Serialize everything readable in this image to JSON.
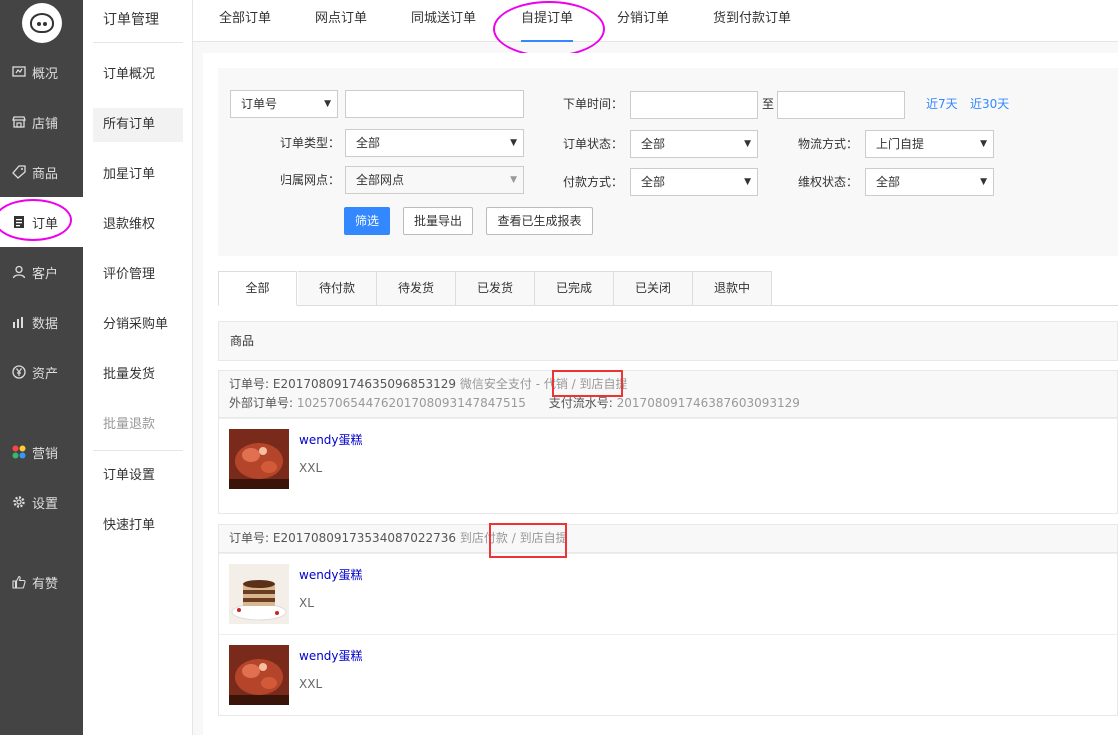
{
  "sidebar": {
    "items": [
      {
        "label": "概况",
        "icon": "overview-icon"
      },
      {
        "label": "店铺",
        "icon": "store-icon"
      },
      {
        "label": "商品",
        "icon": "tag-icon"
      },
      {
        "label": "订单",
        "icon": "order-icon"
      },
      {
        "label": "客户",
        "icon": "user-icon"
      },
      {
        "label": "数据",
        "icon": "chart-icon"
      },
      {
        "label": "资产",
        "icon": "yen-icon"
      },
      {
        "label": "营销",
        "icon": "apps-icon"
      },
      {
        "label": "设置",
        "icon": "gear-icon"
      },
      {
        "label": "有赞",
        "icon": "thumbs-up-icon"
      }
    ]
  },
  "subnav": {
    "title": "订单管理",
    "items": [
      "订单概况",
      "所有订单",
      "加星订单",
      "退款维权",
      "评价管理",
      "分销采购单",
      "批量发货",
      "批量退款",
      "订单设置",
      "快速打单"
    ]
  },
  "toptabs": [
    "全部订单",
    "网点订单",
    "同城送订单",
    "自提订单",
    "分销订单",
    "货到付款订单"
  ],
  "filter": {
    "order_no_select": "订单号",
    "order_time_label": "下单时间：",
    "to_label": "至",
    "last7": "近7天",
    "last30": "近30天",
    "order_type_label": "订单类型：",
    "order_type_value": "全部",
    "order_status_label": "订单状态：",
    "order_status_value": "全部",
    "logistics_label": "物流方式：",
    "logistics_value": "上门自提",
    "outlet_label": "归属网点：",
    "outlet_value": "全部网点",
    "pay_label": "付款方式：",
    "pay_value": "全部",
    "rights_label": "维权状态：",
    "rights_value": "全部",
    "filter_btn": "筛选",
    "export_btn": "批量导出",
    "report_btn": "查看已生成报表"
  },
  "status_tabs": [
    "全部",
    "待付款",
    "待发货",
    "已发货",
    "已完成",
    "已关闭",
    "退款中"
  ],
  "table_header": "商品",
  "orders": [
    {
      "order_no_label": "订单号: ",
      "order_no": "E20170809174635096853129",
      "pay": "微信安全支付 - 代销",
      "sep": " / ",
      "pickup": "到店自提",
      "ext_label": "外部订单号: ",
      "ext_no": "1025706544762017080931478475​15",
      "flow_label": "支付流水号: ",
      "flow_no": "2017080917463876030931​29",
      "items": [
        {
          "name": "wendy蛋糕",
          "sku": "XXL",
          "img": "cake-red-image"
        }
      ]
    },
    {
      "order_no_label": "订单号: ",
      "order_no": "E20170809173534087022736",
      "pay": "到店付款",
      "sep": " / ",
      "pickup": "到店自提",
      "items": [
        {
          "name": "wendy蛋糕",
          "sku": "XL",
          "img": "cake-tiramisu-image"
        },
        {
          "name": "wendy蛋糕",
          "sku": "XXL",
          "img": "cake-red-image"
        }
      ]
    }
  ],
  "colors": {
    "accent": "#3388ff",
    "sidebar": "#444444",
    "highlight_box": "#ee3333",
    "annotation_circle": "#ee00ee",
    "link": "#0000cc"
  }
}
